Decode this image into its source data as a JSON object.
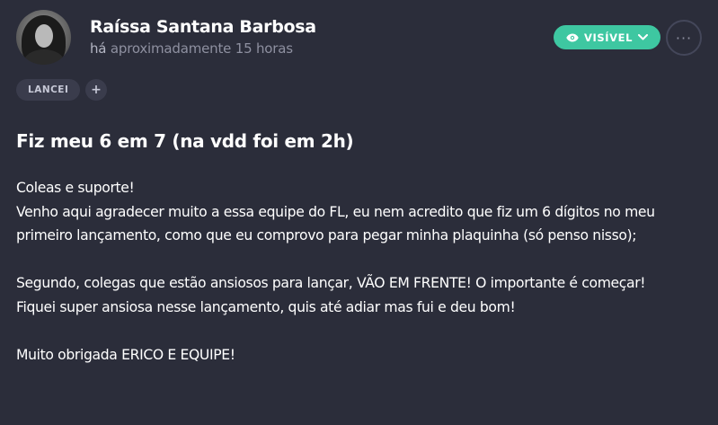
{
  "author": {
    "name": "Raíssa Santana Barbosa",
    "timestamp_prefix": "há",
    "timestamp_text": "aproximadamente 15 horas"
  },
  "header": {
    "visibility_label": "VISÍVEL",
    "more_label": "···",
    "accent_color": "#3ec7a1"
  },
  "tags": {
    "items": [
      {
        "label": "LANCEI"
      }
    ],
    "add_label": "+"
  },
  "post": {
    "title": "Fiz meu 6 em 7 (na vdd foi em 2h)",
    "paragraphs": [
      [
        "Coleas e suporte!",
        "Venho aqui agradecer muito a essa equipe do FL, eu nem acredito que fiz um 6 dígitos no meu primeiro lançamento, como que eu comprovo para pegar minha plaquinha (só penso nisso);"
      ],
      [
        "Segundo, colegas que estão ansiosos para lançar, VÃO EM FRENTE! O importante é começar!",
        "Fiquei super ansiosa nesse lançamento, quis até adiar mas fui e deu bom!"
      ],
      [
        "Muito obrigada ERICO E EQUIPE!"
      ]
    ]
  },
  "icons": {
    "visibility": "eye-icon",
    "dropdown": "chevron-down-icon",
    "more": "more-dots-icon"
  }
}
